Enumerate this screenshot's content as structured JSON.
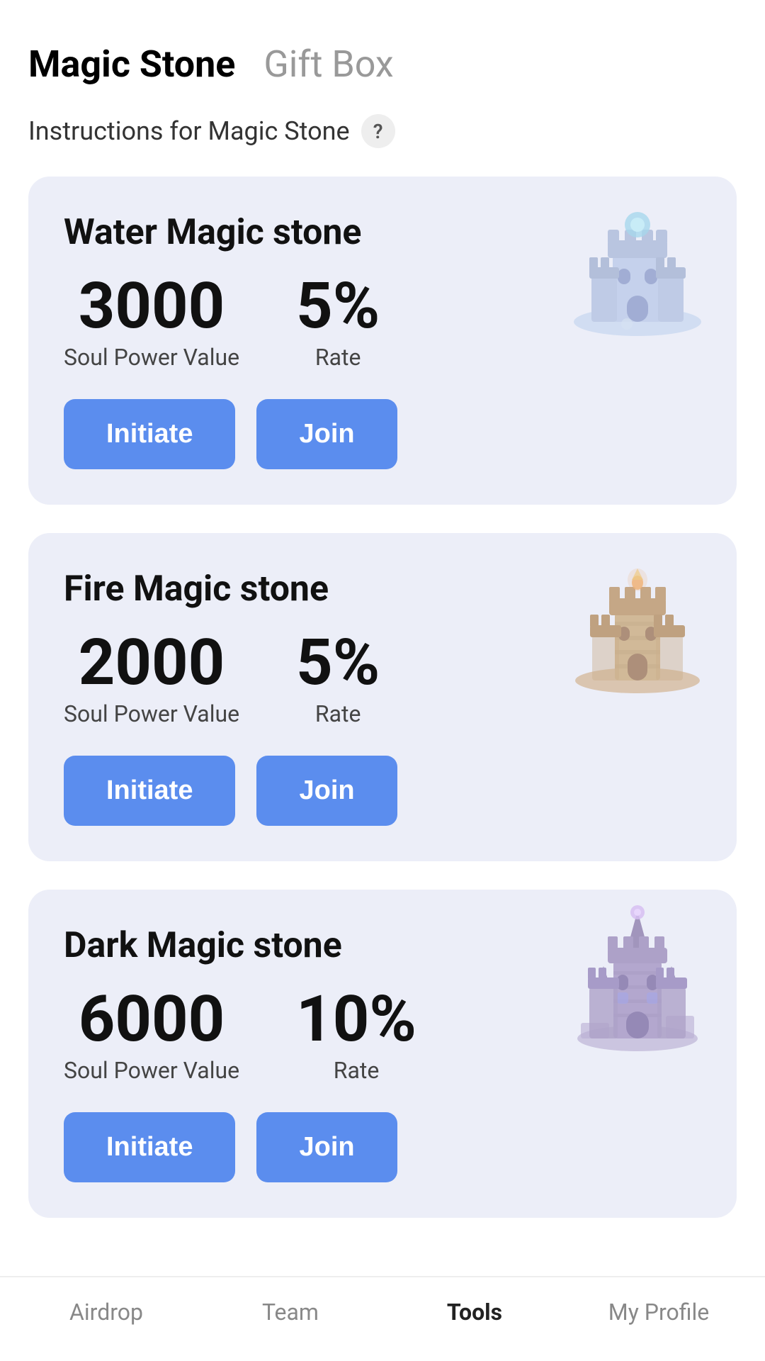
{
  "header": {
    "title_active": "Magic Stone",
    "title_inactive": "Gift Box"
  },
  "instructions": {
    "text": "Instructions for Magic Stone",
    "icon": "?"
  },
  "cards": [
    {
      "id": "water",
      "title": "Water Magic stone",
      "soul_power_value": "3000",
      "soul_power_label": "Soul Power Value",
      "rate_value": "5%",
      "rate_label": "Rate",
      "initiate_label": "Initiate",
      "join_label": "Join",
      "castle_type": "water"
    },
    {
      "id": "fire",
      "title": "Fire Magic stone",
      "soul_power_value": "2000",
      "soul_power_label": "Soul Power Value",
      "rate_value": "5%",
      "rate_label": "Rate",
      "initiate_label": "Initiate",
      "join_label": "Join",
      "castle_type": "fire"
    },
    {
      "id": "dark",
      "title": "Dark Magic stone",
      "soul_power_value": "6000",
      "soul_power_label": "Soul Power Value",
      "rate_value": "10%",
      "rate_label": "Rate",
      "initiate_label": "Initiate",
      "join_label": "Join",
      "castle_type": "dark"
    }
  ],
  "nav": {
    "items": [
      {
        "id": "airdrop",
        "label": "Airdrop",
        "active": false
      },
      {
        "id": "team",
        "label": "Team",
        "active": false
      },
      {
        "id": "tools",
        "label": "Tools",
        "active": true
      },
      {
        "id": "myprofile",
        "label": "My Profile",
        "active": false
      }
    ]
  }
}
